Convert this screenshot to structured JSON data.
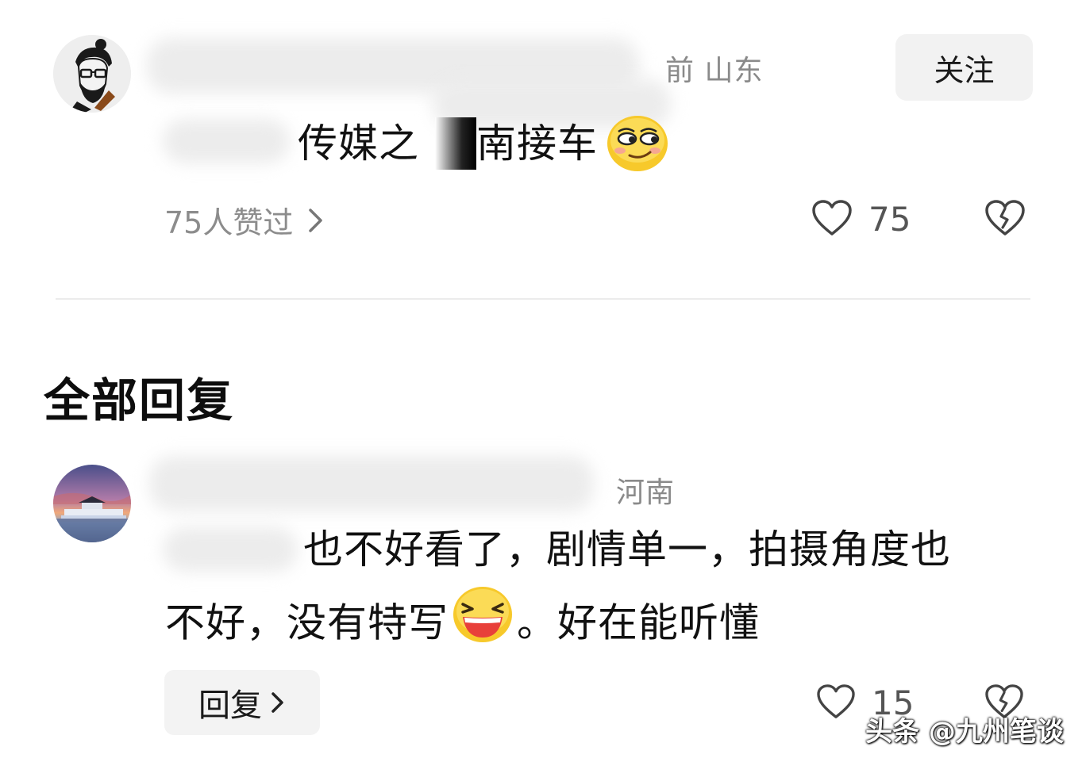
{
  "comment": {
    "location": "前  山东",
    "follow_label": "关注",
    "text_a": "传媒之",
    "text_b": "南接车",
    "likes_link": "75人赞过",
    "like_count": "75"
  },
  "replies_section": {
    "title": "全部回复"
  },
  "reply": {
    "location": "河南",
    "line1": "也不好看了，剧情单一，拍摄角度也",
    "line2_a": "不好，没有特写",
    "line2_b": "。好在能听懂",
    "reply_label": "回复",
    "like_count": "15"
  },
  "watermark": "头条 @九州笔谈",
  "icons": {
    "heart": "heart-icon",
    "broken_heart": "broken-heart-icon",
    "chevron": "chevron-right-icon",
    "smirk_emoji": "smirk-emoji-icon",
    "laugh_emoji": "laugh-emoji-icon"
  },
  "colors": {
    "meta_gray": "#8a8a8a",
    "button_bg": "#f2f2f2",
    "divider": "#ececec"
  }
}
